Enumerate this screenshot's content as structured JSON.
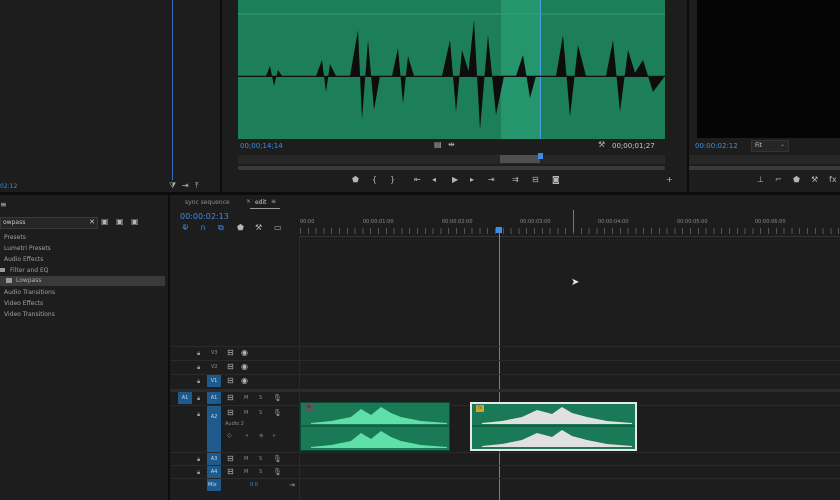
{
  "source_monitor": {
    "timecode_in": "00;00;14;14",
    "timecode_dur": "00;00;01;27"
  },
  "program_monitor": {
    "timecode": "00:00:02:12",
    "fit_label": "Fit"
  },
  "left_timecode": "02:12",
  "effects_panel": {
    "search_value": "owpass",
    "items": [
      "Presets",
      "Lumetri Presets",
      "Audio Effects",
      "Filter and EQ",
      "Lowpass",
      "Audio Transitions",
      "Video Effects",
      "Video Transitions"
    ]
  },
  "timeline": {
    "tabs": [
      "sync sequence",
      "edit"
    ],
    "timecode": "00:00:02:13",
    "ruler": [
      "00:00",
      "00:00:01:00",
      "00:00:02:00",
      "00:00:03:00",
      "00:00:04:00",
      "00:00:05:00",
      "00:00:06:00"
    ],
    "video_tracks": [
      "V3",
      "V2",
      "V1"
    ],
    "audio_tracks": [
      "A1",
      "A2",
      "A3",
      "A4"
    ],
    "a1_source": "A1",
    "audio2_name": "Audio 2",
    "mix_label": "Mix",
    "mix_value": "0.0",
    "mute_label": "M",
    "solo_label": "S",
    "clip_badge_a": "fx",
    "clip_badge_b": "fx"
  },
  "colors": {
    "waveform_bg": "#1d7f5a",
    "accent_blue": "#3d8ee0",
    "clip_green": "#1a7a58"
  }
}
